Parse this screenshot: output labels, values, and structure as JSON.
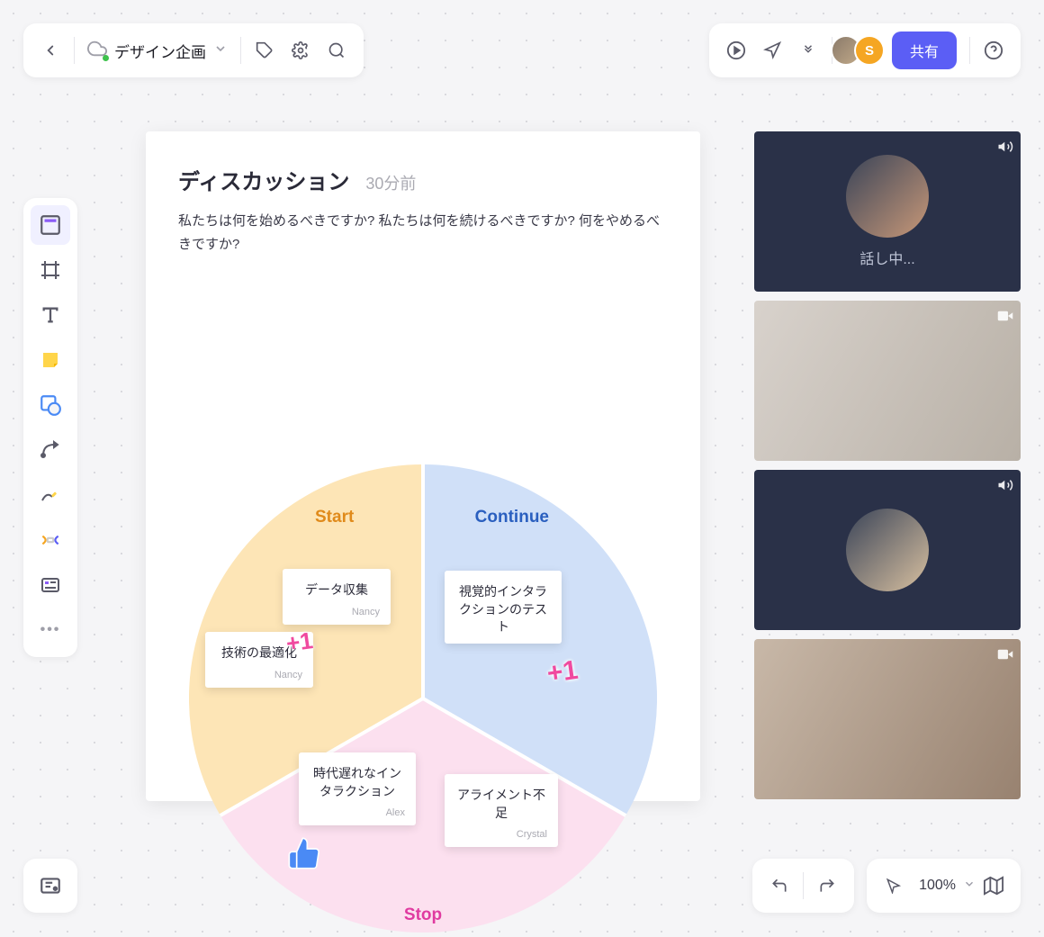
{
  "header": {
    "breadcrumb_title": "デザイン企画",
    "share_label": "共有",
    "user2_initial": "S"
  },
  "card": {
    "title": "ディスカッション",
    "timestamp": "30分前",
    "description": "私たちは何を始めるべきですか? 私たちは何を続けるべきですか? 何をやめるべきですか?"
  },
  "segments": {
    "start": "Start",
    "continue": "Continue",
    "stop": "Stop"
  },
  "notes": {
    "n1": {
      "text": "データ収集",
      "author": "Nancy"
    },
    "n2": {
      "text": "技術の最適化",
      "author": "Nancy"
    },
    "n3": {
      "text": "視覚的インタラクションのテスト",
      "author": ""
    },
    "n4": {
      "text": "時代遅れなインタラクション",
      "author": "Alex"
    },
    "n5": {
      "text": "アライメント不足",
      "author": "Crystal"
    }
  },
  "stickers": {
    "plus1": "+1"
  },
  "video": {
    "talking": "話し中..."
  },
  "footer": {
    "zoom": "100%"
  }
}
